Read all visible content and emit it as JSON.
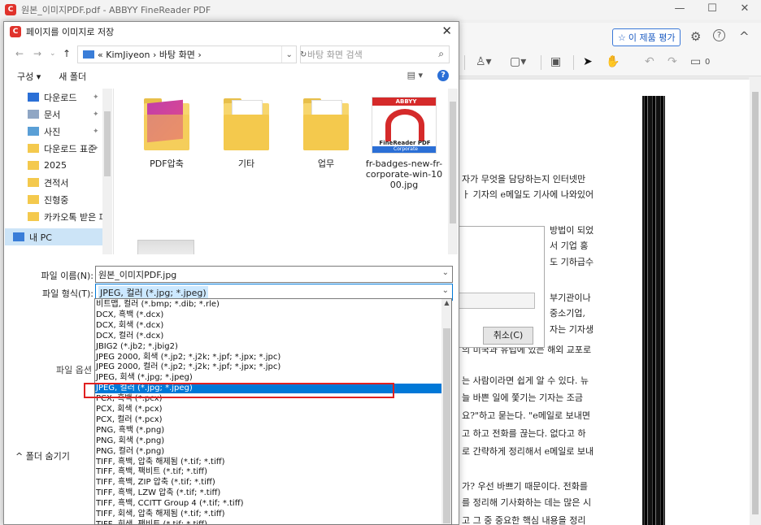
{
  "app": {
    "title": "원본_이미지PDF.pdf - ABBYY FineReader PDF",
    "logo_letter": "C",
    "window_controls": [
      "—",
      "☐",
      "✕"
    ]
  },
  "toolbar": {
    "rate_button": "이 제품 평가",
    "settings_icon": "⚙",
    "help_icon": "?",
    "collapse_icon": "^",
    "comment_count": "0"
  },
  "document": {
    "lines": [
      "자가 무엇을 담당하는지 인터넷만",
      "ㅏ 기자의 e메일도 기사에 나와있어",
      "방법이 되었",
      "서 기업 홍",
      "도 기하급수",
      "부기관이나",
      "중소기업,",
      "자는 기자생",
      "의 미국과 유럽에 있는 해외 교포로",
      "는 사람이라면 쉽게 알 수 있다. 뉴",
      "늘 바쁜 일에 쫓기는 기자는 조금",
      "요?\"하고 묻는다. \"e메일로 보내면",
      "고 하고 전화를 끊는다. 없다고 하",
      "로 간략하게 정리해서 e메일로 보내",
      "가? 우선 바쁘기 때문이다. 전화를",
      "를 정리해 기사화하는 데는 많은 시",
      "고 그 중 중요한 핵심 내용을 정리"
    ],
    "cancel_button": "취소(C)"
  },
  "dialog": {
    "title": "페이지를 이미지로 저장",
    "close_icon": "✕",
    "nav_back": "←",
    "nav_forward": "→",
    "nav_up": "↑",
    "address": "« KimJiyeon › 바탕 화면 ›",
    "refresh_icon": "↻",
    "search_placeholder": "바탕 화면 검색",
    "search_icon": "⌕",
    "organize": "구성 ▾",
    "new_folder": "새 폴더",
    "view_icon": "▤ ▾",
    "help_icon": "?",
    "nav_items": [
      {
        "label": "다운로드",
        "pinned": true,
        "color": "#2b6fd6"
      },
      {
        "label": "문서",
        "pinned": true,
        "color": "#8fa6c4"
      },
      {
        "label": "사진",
        "pinned": true,
        "color": "#5a9fd6"
      },
      {
        "label": "다운로드 표준",
        "pinned": true,
        "color": "#f4c94d"
      },
      {
        "label": "2025",
        "pinned": false,
        "color": "#f4c94d"
      },
      {
        "label": "견적서",
        "pinned": false,
        "color": "#f4c94d"
      },
      {
        "label": "진형중",
        "pinned": false,
        "color": "#f4c94d"
      },
      {
        "label": "카카오톡 받은 파",
        "pinned": false,
        "color": "#f4c94d"
      },
      {
        "label": "내 PC",
        "pinned": false,
        "color": "#3a7dd8"
      }
    ],
    "files": [
      {
        "name": "PDF압축",
        "kind": "folder-pink"
      },
      {
        "name": "기타",
        "kind": "folder"
      },
      {
        "name": "업무",
        "kind": "folder"
      },
      {
        "name": "fr-badges-new-fr-corporate-win-1000.jpg",
        "kind": "abbyy"
      }
    ],
    "abbyy_badge": {
      "header": "ABBYY",
      "label": "FineReader PDF",
      "sub": "Corporate"
    },
    "filename_label": "파일 이름(N):",
    "filename_value": "원본_이미지PDF.jpg",
    "filetype_label": "파일 형식(T):",
    "filetype_value": "JPEG, 컬러 (*.jpg; *.jpeg)",
    "options_label": "파일 옵션",
    "hide_folders": "^ 폴더 숨기기",
    "filetype_options": [
      "비트맵, 컬러 (*.bmp; *.dib; *.rle)",
      "DCX, 흑백 (*.dcx)",
      "DCX, 회색 (*.dcx)",
      "DCX, 컬러 (*.dcx)",
      "JBIG2 (*.jb2; *.jbig2)",
      "JPEG 2000, 회색 (*.jp2; *.j2k; *.jpf; *.jpx; *.jpc)",
      "JPEG 2000, 컬러 (*.jp2; *.j2k; *.jpf; *.jpx; *.jpc)",
      "JPEG, 회색 (*.jpg; *.jpeg)",
      "JPEG, 컬러 (*.jpg; *.jpeg)",
      "PCX, 흑백 (*.pcx)",
      "PCX, 회색 (*.pcx)",
      "PCX, 컬러 (*.pcx)",
      "PNG, 흑백 (*.png)",
      "PNG, 회색 (*.png)",
      "PNG, 컬러 (*.png)",
      "TIFF, 흑백, 압축 해제됨 (*.tif; *.tiff)",
      "TIFF, 흑백, 팩비트 (*.tif; *.tiff)",
      "TIFF, 흑백, ZIP 압축 (*.tif; *.tiff)",
      "TIFF, 흑백, LZW 압축 (*.tif; *.tiff)",
      "TIFF, 흑백, CCITT Group 4 (*.tif; *.tiff)",
      "TIFF, 회색, 압축 해제됨 (*.tif; *.tiff)",
      "TIFF, 회색, 팩비트 (*.tif; *.tiff)"
    ],
    "selected_option": 8
  },
  "colors": {
    "accent": "#0078d7",
    "highlight_box": "#e02020",
    "brand": "#e0332c"
  }
}
